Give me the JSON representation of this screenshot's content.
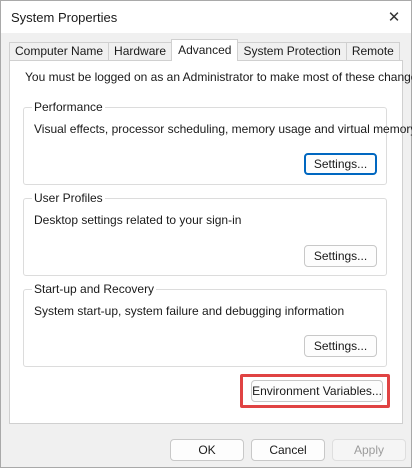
{
  "window": {
    "title": "System Properties",
    "close_icon": "close-icon"
  },
  "tabs": [
    {
      "label": "Computer Name",
      "active": false
    },
    {
      "label": "Hardware",
      "active": false
    },
    {
      "label": "Advanced",
      "active": true
    },
    {
      "label": "System Protection",
      "active": false
    },
    {
      "label": "Remote",
      "active": false
    }
  ],
  "advanced": {
    "intro": "You must be logged on as an Administrator to make most of these changes.",
    "performance": {
      "title": "Performance",
      "description": "Visual effects, processor scheduling, memory usage and virtual memory",
      "button": "Settings..."
    },
    "user_profiles": {
      "title": "User Profiles",
      "description": "Desktop settings related to your sign-in",
      "button": "Settings..."
    },
    "startup_recovery": {
      "title": "Start-up and Recovery",
      "description": "System start-up, system failure and debugging information",
      "button": "Settings..."
    },
    "env_button": "Environment Variables..."
  },
  "footer": {
    "ok": "OK",
    "cancel": "Cancel",
    "apply": "Apply"
  },
  "colors": {
    "highlight": "#e04343",
    "focus": "#0067c0"
  }
}
